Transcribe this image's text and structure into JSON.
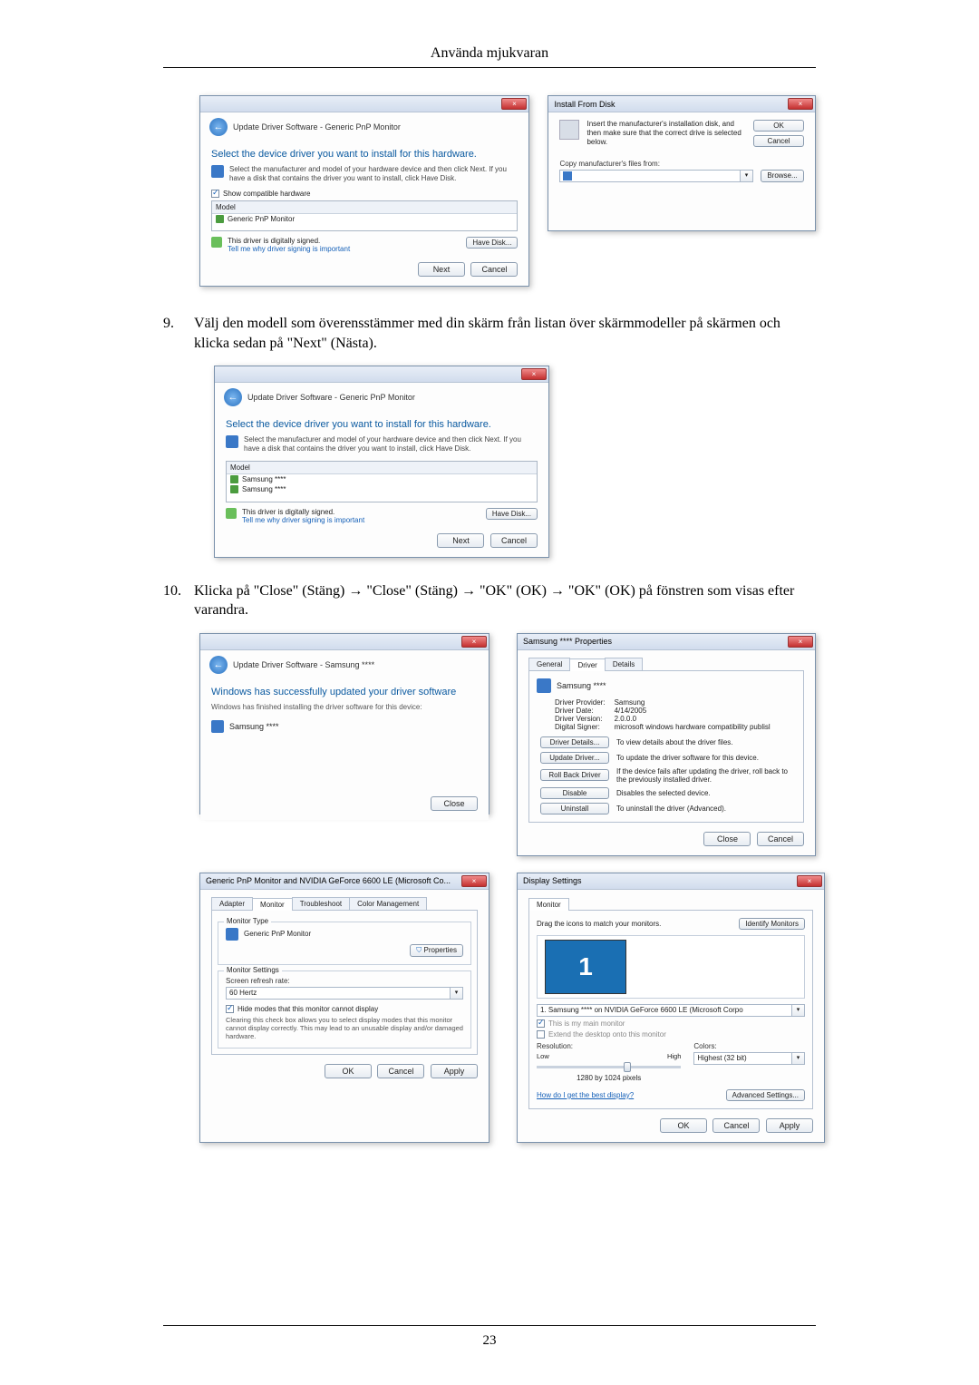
{
  "header": {
    "title": "Använda mjukvaran"
  },
  "page_number": "23",
  "steps": {
    "s9": {
      "num": "9.",
      "text": "Välj den modell som överensstämmer med din skärm från listan över skärmmodeller på skärmen och klicka sedan på \"Next\" (Nästa)."
    },
    "s10": {
      "num": "10.",
      "text": "Klicka på \"Close\" (Stäng) → \"Close\" (Stäng) → \"OK\" (OK) → \"OK\" (OK) på fönstren som visas efter varandra."
    }
  },
  "dlg_update1": {
    "crumb": "Update Driver Software - Generic PnP Monitor",
    "heading": "Select the device driver you want to install for this hardware.",
    "sub": "Select the manufacturer and model of your hardware device and then click Next. If you have a disk that contains the driver you want to install, click Have Disk.",
    "chk_compat": "Show compatible hardware",
    "col_model": "Model",
    "row1": "Generic PnP Monitor",
    "signed": "This driver is digitally signed.",
    "signed_link": "Tell me why driver signing is important",
    "btn_have_disk": "Have Disk...",
    "btn_next": "Next",
    "btn_cancel": "Cancel"
  },
  "dlg_install_from_disk": {
    "title": "Install From Disk",
    "msg": "Insert the manufacturer's installation disk, and then make sure that the correct drive is selected below.",
    "btn_ok": "OK",
    "btn_cancel": "Cancel",
    "lbl_copy": "Copy manufacturer's files from:",
    "btn_browse": "Browse..."
  },
  "dlg_update2": {
    "crumb": "Update Driver Software - Generic PnP Monitor",
    "heading": "Select the device driver you want to install for this hardware.",
    "sub": "Select the manufacturer and model of your hardware device and then click Next. If you have a disk that contains the driver you want to install, click Have Disk.",
    "col_model": "Model",
    "row1": "Samsung ****",
    "row2": "Samsung ****",
    "signed": "This driver is digitally signed.",
    "signed_link": "Tell me why driver signing is important",
    "btn_have_disk": "Have Disk...",
    "btn_next": "Next",
    "btn_cancel": "Cancel"
  },
  "dlg_update_done": {
    "crumb": "Update Driver Software - Samsung ****",
    "heading": "Windows has successfully updated your driver software",
    "sub": "Windows has finished installing the driver software for this device:",
    "device": "Samsung ****",
    "btn_close": "Close"
  },
  "dlg_props": {
    "title": "Samsung **** Properties",
    "tab_general": "General",
    "tab_driver": "Driver",
    "tab_details": "Details",
    "device": "Samsung ****",
    "lbl_provider": "Driver Provider:",
    "val_provider": "Samsung",
    "lbl_date": "Driver Date:",
    "val_date": "4/14/2005",
    "lbl_version": "Driver Version:",
    "val_version": "2.0.0.0",
    "lbl_signer": "Digital Signer:",
    "val_signer": "microsoft windows hardware compatibility publisl",
    "btn_details": "Driver Details...",
    "desc_details": "To view details about the driver files.",
    "btn_update": "Update Driver...",
    "desc_update": "To update the driver software for this device.",
    "btn_rollback": "Roll Back Driver",
    "desc_rollback": "If the device fails after updating the driver, roll back to the previously installed driver.",
    "btn_disable": "Disable",
    "desc_disable": "Disables the selected device.",
    "btn_uninstall": "Uninstall",
    "desc_uninstall": "To uninstall the driver (Advanced).",
    "btn_close": "Close",
    "btn_cancel": "Cancel"
  },
  "dlg_geforce": {
    "title": "Generic PnP Monitor and NVIDIA GeForce 6600 LE (Microsoft Co...",
    "tab_adapter": "Adapter",
    "tab_monitor": "Monitor",
    "tab_trouble": "Troubleshoot",
    "tab_color": "Color Management",
    "grp_type": "Monitor Type",
    "monitor_name": "Generic PnP Monitor",
    "btn_props": "Properties",
    "grp_settings": "Monitor Settings",
    "lbl_refresh": "Screen refresh rate:",
    "val_refresh": "60 Hertz",
    "chk_hide": "Hide modes that this monitor cannot display",
    "hide_desc": "Clearing this check box allows you to select display modes that this monitor cannot display correctly. This may lead to an unusable display and/or damaged hardware.",
    "btn_ok": "OK",
    "btn_cancel": "Cancel",
    "btn_apply": "Apply"
  },
  "dlg_display": {
    "title": "Display Settings",
    "tab_monitor": "Monitor",
    "drag": "Drag the icons to match your monitors.",
    "btn_identify": "Identify Monitors",
    "dd_monitor": "1. Samsung **** on NVIDIA GeForce 6600 LE (Microsoft Corpo",
    "chk_main": "This is my main monitor",
    "chk_extend": "Extend the desktop onto this monitor",
    "lbl_res": "Resolution:",
    "lbl_low": "Low",
    "lbl_high": "High",
    "val_res": "1280 by 1024 pixels",
    "lbl_colors": "Colors:",
    "val_colors": "Highest (32 bit)",
    "link_best": "How do I get the best display?",
    "btn_adv": "Advanced Settings...",
    "btn_ok": "OK",
    "btn_cancel": "Cancel",
    "btn_apply": "Apply"
  }
}
